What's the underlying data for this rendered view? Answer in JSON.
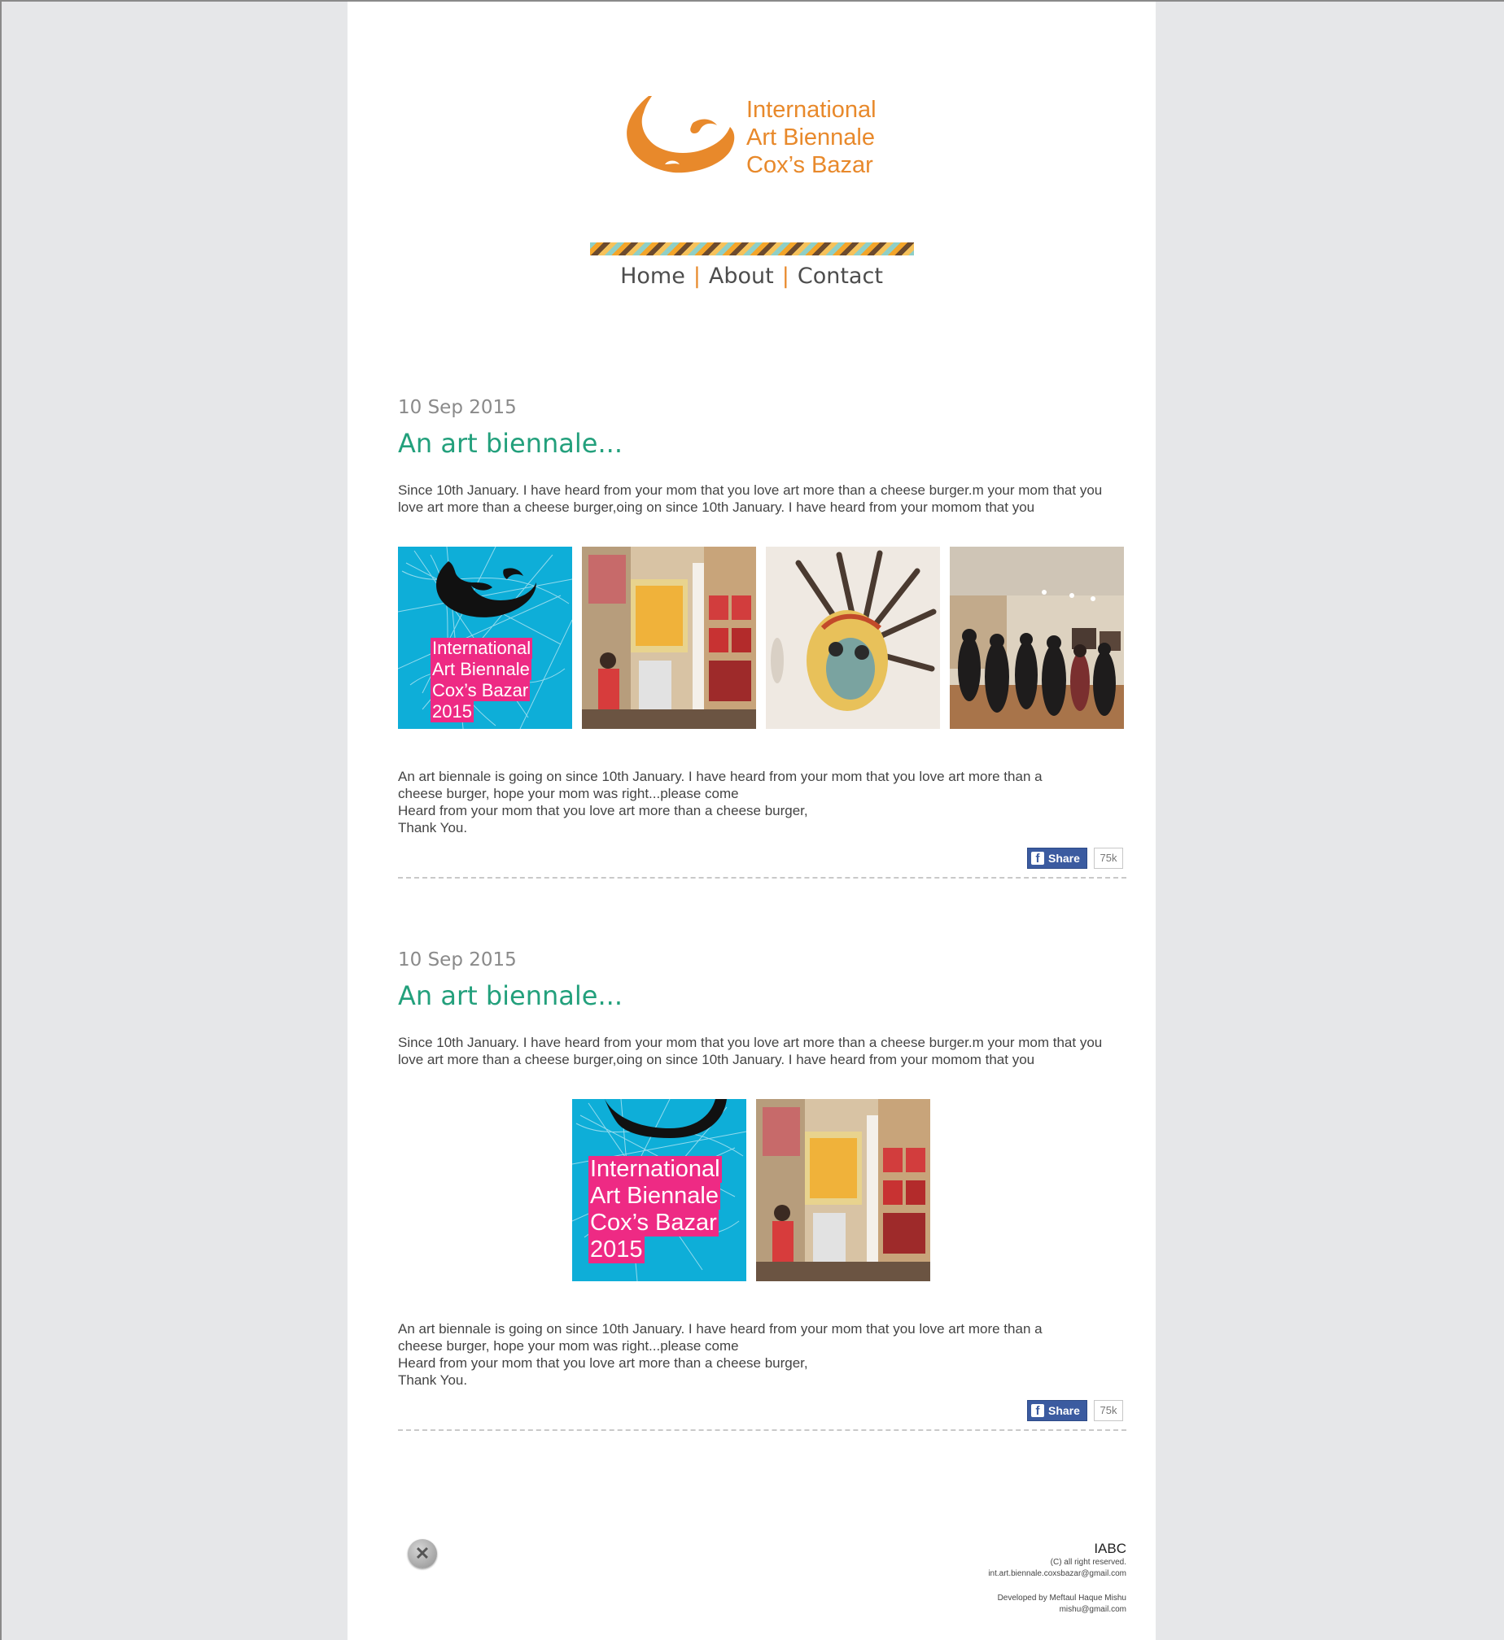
{
  "brand": {
    "logo_lines": [
      "International",
      "Art Biennale",
      "Cox’s Bazar"
    ],
    "color": "#e8892b"
  },
  "nav": {
    "items": [
      "Home",
      "About",
      "Contact"
    ],
    "separator": "|"
  },
  "posts": [
    {
      "date": "10 Sep 2015",
      "title": "An art biennale...",
      "intro": "Since 10th January. I have heard from your mom that you love art more than a cheese burger.m your mom that you love art more than a cheese burger,oing on since 10th January. I have heard from your momom that you",
      "images": [
        "biennale-poster",
        "gallery-paintings",
        "feather-mask",
        "exhibition-visitors"
      ],
      "body_lines": [
        "An art biennale is going on since 10th January. I have heard from your mom that you love art more than a",
        "cheese burger, hope your mom was right...please come",
        "Heard from your mom that you love art more than a cheese burger,",
        "Thank You."
      ],
      "share_label": "Share",
      "share_count": "75k"
    },
    {
      "date": "10 Sep 2015",
      "title": "An art biennale...",
      "intro": "Since 10th January. I have heard from your mom that you love art more than a cheese burger.m your mom that you love art more than a cheese burger,oing on since 10th January. I have heard from your momom that you",
      "images": [
        "biennale-poster",
        "gallery-paintings"
      ],
      "body_lines": [
        "An art biennale is going on since 10th January. I have heard from your mom that you love art more than a",
        "cheese burger, hope your mom was right...please come",
        "Heard from your mom that you love art more than a cheese burger,",
        "Thank You."
      ],
      "share_label": "Share",
      "share_count": "75k"
    }
  ],
  "poster": {
    "lines": [
      "International",
      "Art Biennale",
      "Cox’s Bazar",
      "2015"
    ],
    "bg_color": "#0eaed8",
    "highlight_color": "#ee2a84"
  },
  "footer": {
    "title": "IABC",
    "rights": "(C) all right reserved.",
    "email": "int.art.biennale.coxsbazar@gmail.com",
    "developer": "Developed by Meftaul Haque Mishu",
    "developer_email": "mishu@gmail.com"
  },
  "colors": {
    "accent_green": "#23a07c",
    "facebook_blue": "#3b5ba0",
    "page_bg": "#e6e7e9"
  }
}
